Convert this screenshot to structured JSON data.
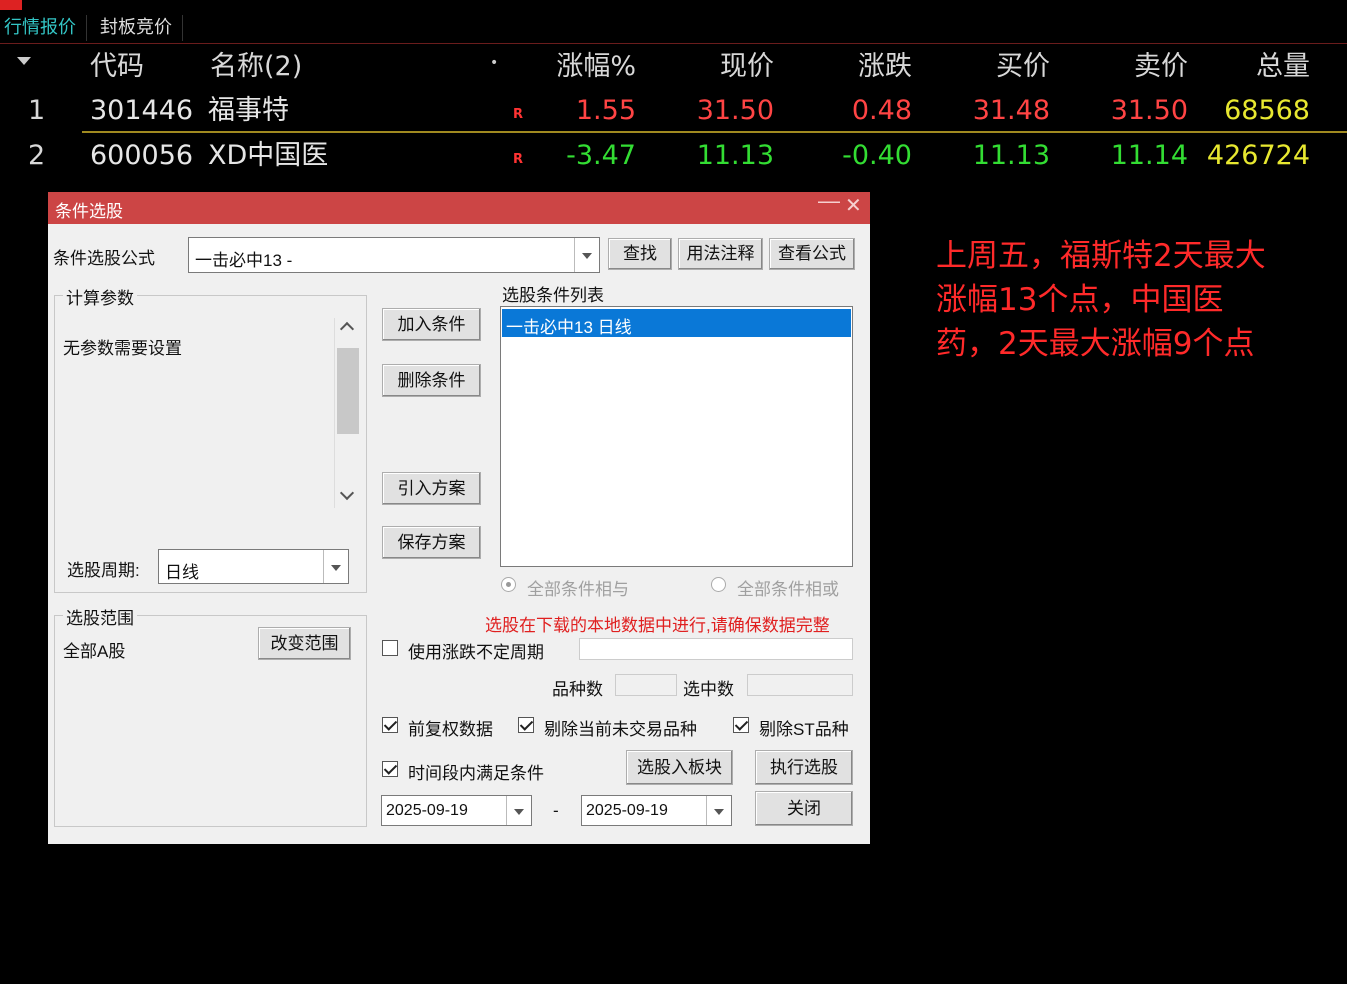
{
  "tabs": [
    {
      "label": "行情报价",
      "active": true
    },
    {
      "label": "封板竞价",
      "active": false
    }
  ],
  "grid": {
    "headers": {
      "code": "代码",
      "name": "名称(2)",
      "dot": "•",
      "change_pct": "涨幅%",
      "price": "现价",
      "change": "涨跌",
      "bid": "买价",
      "ask": "卖价",
      "volume": "总量"
    },
    "rows": [
      {
        "idx": "1",
        "code": "301446",
        "name": "福事特",
        "mark": "R",
        "change_pct": "1.55",
        "price": "31.50",
        "change": "0.48",
        "bid": "31.48",
        "ask": "31.50",
        "volume": "68568",
        "trend": "up"
      },
      {
        "idx": "2",
        "code": "600056",
        "name": "XD中国医",
        "mark": "R",
        "change_pct": "-3.47",
        "price": "11.13",
        "change": "-0.40",
        "bid": "11.13",
        "ask": "11.14",
        "volume": "426724",
        "trend": "down"
      }
    ]
  },
  "dialog": {
    "title": "条件选股",
    "minimize_glyph": "—",
    "close_glyph": "✕",
    "formula_label": "条件选股公式",
    "formula_value": "一击必中13  -",
    "btn_find": "查找",
    "btn_usage": "用法注释",
    "btn_view": "查看公式",
    "params_group": "计算参数",
    "params_text": "无参数需要设置",
    "period_label": "选股周期:",
    "period_value": "日线",
    "range_group": "选股范围",
    "range_value": "全部A股",
    "btn_change_range": "改变范围",
    "btn_add": "加入条件",
    "btn_delete": "删除条件",
    "btn_import": "引入方案",
    "btn_save": "保存方案",
    "list_label": "选股条件列表",
    "conditions": [
      "一击必中13  日线"
    ],
    "radio_and": "全部条件相与",
    "radio_or": "全部条件相或",
    "warning": "选股在下载的本地数据中进行,请确保数据完整",
    "chk_variable_period": "使用涨跌不定周期",
    "count_label": "品种数",
    "selected_label": "选中数",
    "chk_forward_adjust": "前复权数据",
    "chk_exclude_untraded": "剔除当前未交易品种",
    "chk_exclude_st": "剔除ST品种",
    "chk_time_range": "时间段内满足条件",
    "btn_to_block": "选股入板块",
    "btn_execute": "执行选股",
    "date_from": "2025-09-19",
    "date_sep": "-",
    "date_to": "2025-09-19",
    "btn_close": "关闭"
  },
  "annotation": {
    "text": "上周五，福斯特2天最大涨幅13个点，中国医药，2天最大涨幅9个点"
  },
  "colors": {
    "up": "#ff4444",
    "down": "#33dd33",
    "volume": "#e8e830",
    "dialog_title": "#cc4545",
    "selected": "#0a78d7",
    "annotation": "#ff2a2a"
  }
}
